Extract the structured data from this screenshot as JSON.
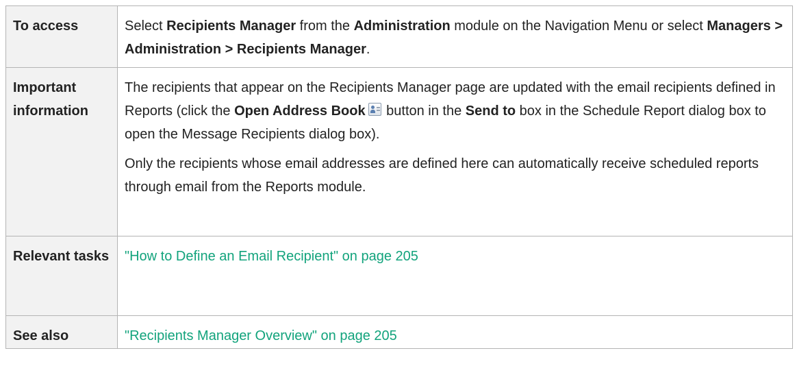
{
  "rows": {
    "access": {
      "label": "To access",
      "t1": "Select ",
      "b1": "Recipients Manager",
      "t2": " from the ",
      "b2": "Administration",
      "t3": " module on the Navigation Menu or select ",
      "b3": "Managers > Administration > Recipients Manager",
      "t4": "."
    },
    "important": {
      "label": "Important information",
      "p1": {
        "t1": "The recipients that appear on the Recipients Manager page are updated with the email recipients defined in Reports (click the ",
        "b1": "Open Address Book",
        "icon": "address-book-icon",
        "t2": " button in the ",
        "b2": "Send to",
        "t3": " box in the Schedule Report dialog box to open the Message Recipients dialog box)."
      },
      "p2": "Only the recipients whose email addresses are defined here can automatically receive scheduled reports through email from the Reports module."
    },
    "tasks": {
      "label": "Relevant tasks",
      "link": "\"How to Define an Email Recipient\" on page 205"
    },
    "see_also": {
      "label": "See also",
      "link": "\"Recipients Manager Overview\" on page 205"
    }
  },
  "colors": {
    "link": "#12a37c",
    "label_background": "#f2f2f2",
    "border": "#b4b4b4"
  }
}
